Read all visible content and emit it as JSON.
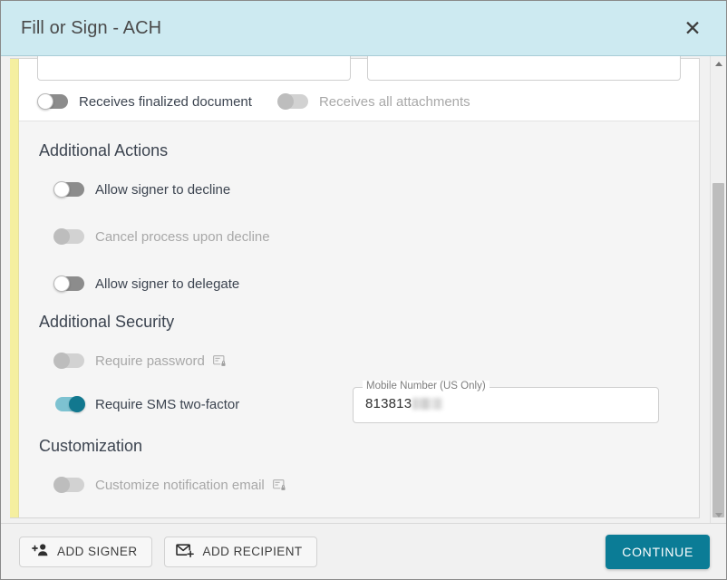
{
  "window": {
    "title": "Fill or Sign - ACH",
    "close_label": "✕"
  },
  "recipient": {
    "field_1_value": "",
    "field_2_value": "",
    "receives_finalized_document": {
      "label": "Receives finalized document",
      "state": "off",
      "enabled": true
    },
    "receives_all_attachments": {
      "label": "Receives all attachments",
      "state": "off",
      "enabled": false
    }
  },
  "sections": [
    {
      "id": "additional-actions",
      "heading": "Additional Actions",
      "options": [
        {
          "id": "allow-signer-to-decline",
          "label": "Allow signer to decline",
          "state": "off",
          "enabled": true,
          "icon": null
        },
        {
          "id": "cancel-process-upon-decline",
          "label": "Cancel process upon decline",
          "state": "off",
          "enabled": false,
          "icon": null
        },
        {
          "id": "allow-signer-to-delegate",
          "label": "Allow signer to delegate",
          "state": "off",
          "enabled": true,
          "icon": null
        }
      ]
    },
    {
      "id": "additional-security",
      "heading": "Additional Security",
      "options": [
        {
          "id": "require-password",
          "label": "Require password",
          "state": "off",
          "enabled": false,
          "icon": "card-lock-icon"
        },
        {
          "id": "require-sms-two-factor",
          "label": "Require SMS two-factor",
          "state": "on",
          "enabled": true,
          "icon": null
        }
      ]
    },
    {
      "id": "customization",
      "heading": "Customization",
      "options": [
        {
          "id": "customize-notification-email",
          "label": "Customize notification email",
          "state": "off",
          "enabled": false,
          "icon": "card-lock-icon"
        }
      ]
    }
  ],
  "mobile_number_field": {
    "label": "Mobile Number (US Only)",
    "value": "813813",
    "redacted_suffix": true
  },
  "footer": {
    "add_signer_label": "ADD SIGNER",
    "add_signer_icon": "add-person-icon",
    "add_recipient_label": "ADD RECIPIENT",
    "add_recipient_icon": "add-envelope-icon",
    "continue_label": "CONTINUE"
  },
  "scrollbar": {
    "up_icon": "caret-up-icon",
    "down_icon": "caret-down-icon",
    "thumb": "scroll-thumb"
  },
  "colors": {
    "header_bg": "#cdeaf1",
    "accent_bar": "#f5efa0",
    "toggle_on_track": "#7dc2d1",
    "toggle_on_knob": "#12788f",
    "primary_button": "#0b7c96",
    "section_bg": "#f5f5f5"
  }
}
